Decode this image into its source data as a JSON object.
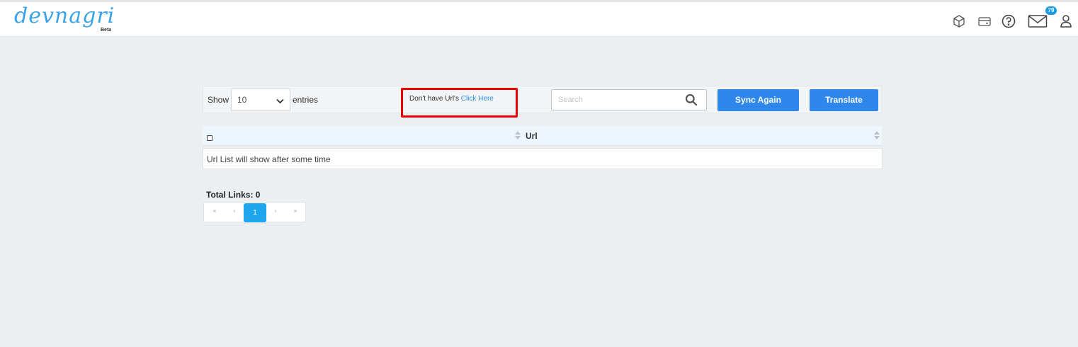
{
  "app": {
    "logo_text": "devnagri",
    "logo_badge": "Beta"
  },
  "header": {
    "icons": [
      "box-icon",
      "card-icon",
      "help-icon",
      "mail-icon",
      "user-icon"
    ],
    "mail_badge": "79",
    "accent": "#1a9be6"
  },
  "toolbar": {
    "show_label": "Show",
    "entries_value": "10",
    "entries_label": "entries",
    "notice_text": "Don't have Url's ",
    "notice_link": "Click Here",
    "highlight_color": "#ee0000",
    "search_placeholder": "Search",
    "sync_label": "Sync Again",
    "translate_label": "Translate",
    "button_color": "#2f86eb"
  },
  "table": {
    "columns": [
      "Url"
    ],
    "empty_message": "Url List will show after some time"
  },
  "footer": {
    "total_links": "Total Links: 0"
  },
  "pagination": {
    "first": "«",
    "prev": "‹",
    "current": "1",
    "next": "›",
    "last": "»"
  }
}
